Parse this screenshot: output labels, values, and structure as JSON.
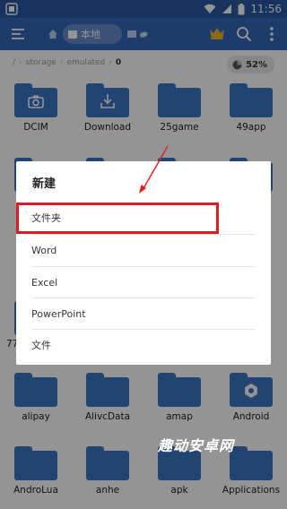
{
  "status": {
    "time": "11:56"
  },
  "toolbar": {
    "location_label": "本地"
  },
  "pathbar": {
    "crumbs": [
      "/",
      "storage",
      "emulated",
      "0"
    ],
    "storage_usage": "52%"
  },
  "grid_items": [
    {
      "label": "DCIM",
      "icon": "camera-icon"
    },
    {
      "label": "Download",
      "icon": "download-icon"
    },
    {
      "label": "25game",
      "icon": "folder-icon"
    },
    {
      "label": "49app",
      "icon": "folder-icon"
    },
    {
      "label": "alipay",
      "icon": "folder-icon"
    },
    {
      "label": "AlivcData",
      "icon": "folder-icon"
    },
    {
      "label": "amap",
      "icon": "folder-icon"
    },
    {
      "label": "Android",
      "icon": "gear-icon"
    },
    {
      "label": "AndroLua",
      "icon": "folder-icon"
    },
    {
      "label": "anhe",
      "icon": "folder-icon"
    },
    {
      "label": "apk",
      "icon": "folder-icon"
    },
    {
      "label": "Applications",
      "icon": "folder-icon"
    }
  ],
  "partial_label": "77",
  "dialog": {
    "title": "新建",
    "options": [
      "文件夹",
      "Word",
      "Excel",
      "PowerPoint",
      "文件"
    ]
  },
  "watermark": "趣动安卓网",
  "colors": {
    "accent": "#3366b8",
    "folder": "#3c75c6",
    "highlight": "#e01c23"
  }
}
